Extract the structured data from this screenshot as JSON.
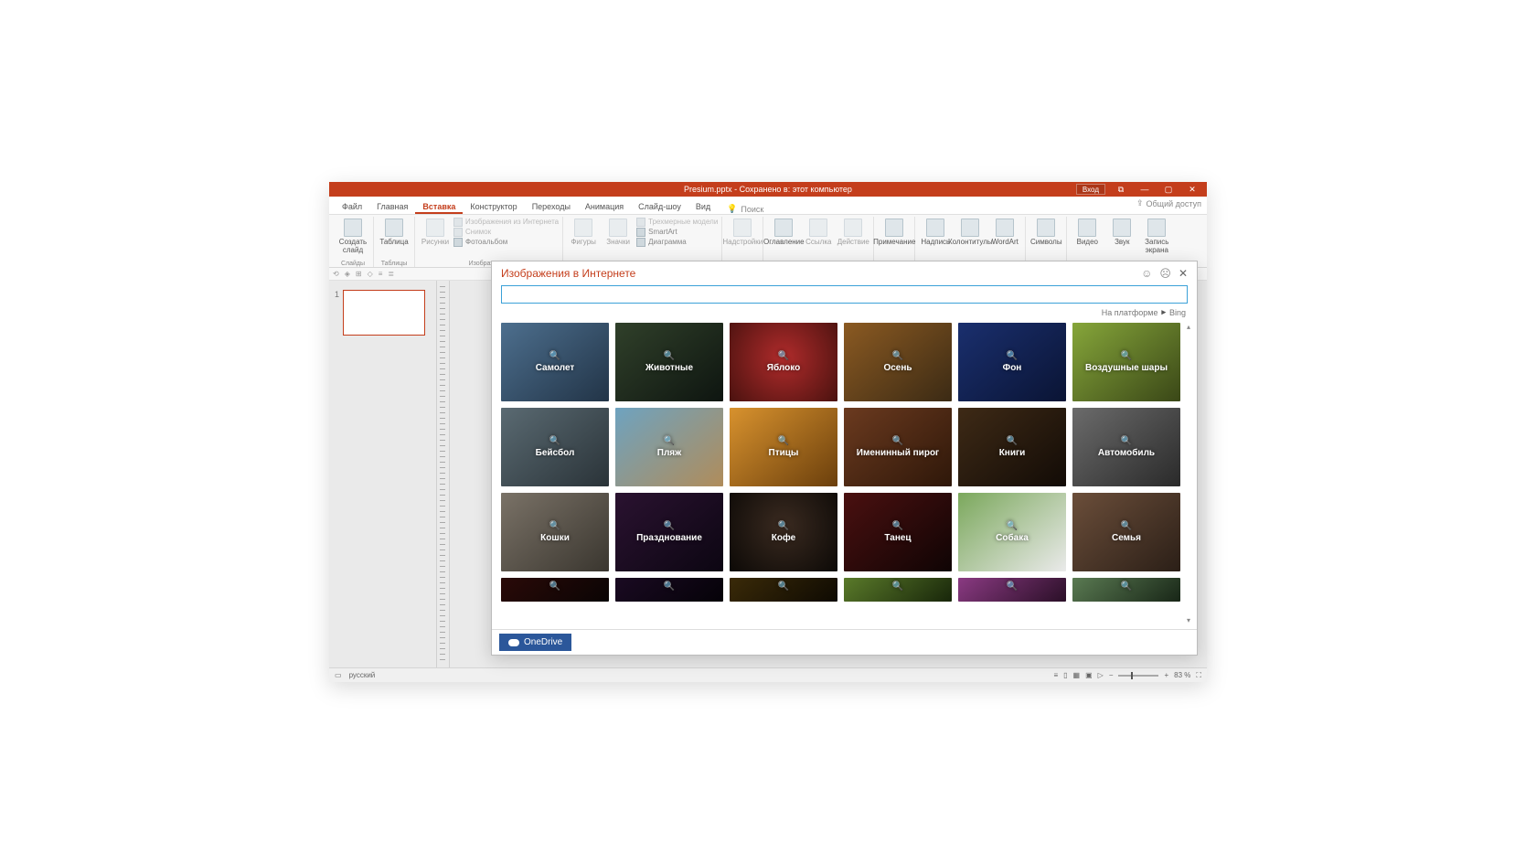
{
  "title": "Presium.pptx - Сохранено в: этот компьютер",
  "titlebar": {
    "login": "Вход",
    "ribbon_opts": "⧉",
    "minimize": "—",
    "maximize": "▢",
    "close": "✕"
  },
  "tabs": [
    "Файл",
    "Главная",
    "Вставка",
    "Конструктор",
    "Переходы",
    "Анимация",
    "Слайд-шоу",
    "Вид"
  ],
  "active_tab": "Вставка",
  "search_label": "Поиск",
  "share_label": "Общий доступ",
  "ribbon": {
    "slides": {
      "new_slide": "Создать\nслайд",
      "label": "Слайды"
    },
    "tables": {
      "table": "Таблица",
      "label": "Таблицы"
    },
    "images": {
      "pictures": "Рисунки",
      "online_pic": "Изображения из Интернета",
      "screenshot": "Снимок",
      "album": "Фотоальбом",
      "label": "Изображения"
    },
    "illus": {
      "shapes": "Фигуры",
      "icons": "Значки",
      "smartart": "SmartArt",
      "chart": "Диаграмма",
      "models3d": "Трехмерные модели"
    },
    "addins": {
      "addins": "Надстройки"
    },
    "links": {
      "toc": "Оглавление",
      "link": "Ссылка",
      "action": "Действие"
    },
    "comments": {
      "comment": "Примечание"
    },
    "text": {
      "textbox": "Надпись",
      "headerfooter": "Колонтитулы",
      "wordart": "WordArt"
    },
    "symbols": {
      "symbols": "Символы"
    },
    "media": {
      "video": "Видео",
      "audio": "Звук",
      "record": "Запись\nэкрана"
    }
  },
  "slide_number": "1",
  "statusbar": {
    "language": "русский",
    "zoom": "83 %"
  },
  "dialog": {
    "title": "Изображения в Интернете",
    "search_placeholder": "",
    "powered_by": "На платформе",
    "bing": "Bing",
    "onedrive": "OneDrive",
    "categories": [
      {
        "label": "Самолет",
        "tint": "t-airplane"
      },
      {
        "label": "Животные",
        "tint": "t-animals"
      },
      {
        "label": "Яблоко",
        "tint": "t-apple"
      },
      {
        "label": "Осень",
        "tint": "t-autumn"
      },
      {
        "label": "Фон",
        "tint": "t-bg"
      },
      {
        "label": "Воздушные шары",
        "tint": "t-balloons"
      },
      {
        "label": "Бейсбол",
        "tint": "t-baseball"
      },
      {
        "label": "Пляж",
        "tint": "t-beach"
      },
      {
        "label": "Птицы",
        "tint": "t-birds"
      },
      {
        "label": "Именинный пирог",
        "tint": "t-cake"
      },
      {
        "label": "Книги",
        "tint": "t-books"
      },
      {
        "label": "Автомобиль",
        "tint": "t-car"
      },
      {
        "label": "Кошки",
        "tint": "t-cats"
      },
      {
        "label": "Празднование",
        "tint": "t-celebr"
      },
      {
        "label": "Кофе",
        "tint": "t-coffee"
      },
      {
        "label": "Танец",
        "tint": "t-dance"
      },
      {
        "label": "Собака",
        "tint": "t-dog"
      },
      {
        "label": "Семья",
        "tint": "t-family"
      }
    ],
    "partial_tints": [
      "t-fire",
      "t-fw",
      "t-fw2",
      "t-fl1",
      "t-fl2",
      "t-fl3"
    ]
  }
}
